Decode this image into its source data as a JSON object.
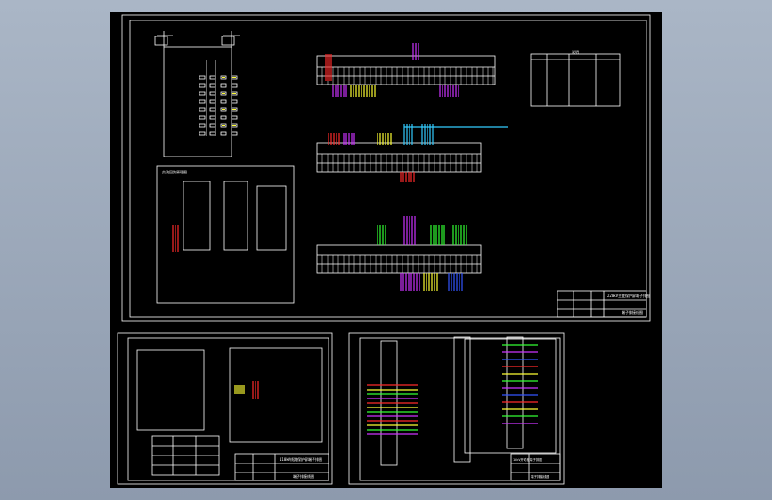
{
  "viewer": {
    "background_top": "#aab6c6",
    "background_bottom": "#8d9aad",
    "canvas_color": "#000000"
  },
  "drawing": {
    "line_color": "#ffffff",
    "wire_colors": [
      "#ff2a2a",
      "#ffff33",
      "#33ff33",
      "#cc33ff",
      "#3355ff",
      "#33ccff",
      "#ff9900"
    ]
  },
  "sheets": [
    {
      "id": "sheet-main",
      "title_block": {
        "text_a": "220kV主变保护屏端子排图",
        "text_b": "端子排接线图"
      }
    },
    {
      "id": "sheet-lower-left",
      "title_block": {
        "text_a": "110kV线路保护屏端子排图",
        "text_b": "端子排接线图"
      }
    },
    {
      "id": "sheet-lower-right",
      "title_block": {
        "text_a": "10kV开关柜端子排图",
        "text_b": "端子排接线图"
      }
    }
  ],
  "tables": {
    "main_info_header": "说明",
    "inset_title": "交流回路原理图"
  }
}
